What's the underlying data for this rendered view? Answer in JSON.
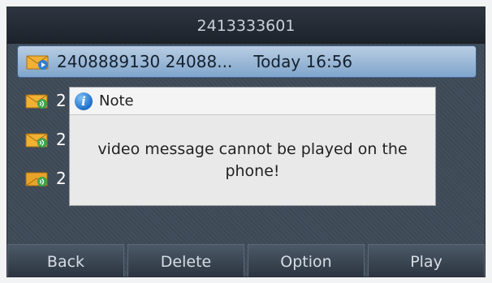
{
  "header": {
    "title": "2413333601"
  },
  "messages": [
    {
      "label": "2408889130 24088...",
      "time": "Today 16:56",
      "selected": true,
      "icon": "video-voicemail-envelope-icon"
    },
    {
      "label": "2",
      "selected": false,
      "icon": "voicemail-envelope-icon"
    },
    {
      "label": "2",
      "selected": false,
      "icon": "voicemail-envelope-icon"
    },
    {
      "label": "2",
      "selected": false,
      "icon": "voicemail-envelope-icon"
    }
  ],
  "dialog": {
    "title": "Note",
    "icon": "info-icon",
    "message": "video message cannot be played on the phone!"
  },
  "softkeys": [
    "Back",
    "Delete",
    "Option",
    "Play"
  ],
  "colors": {
    "selection": "#9dbad9",
    "header_text": "#c9d0d8"
  }
}
